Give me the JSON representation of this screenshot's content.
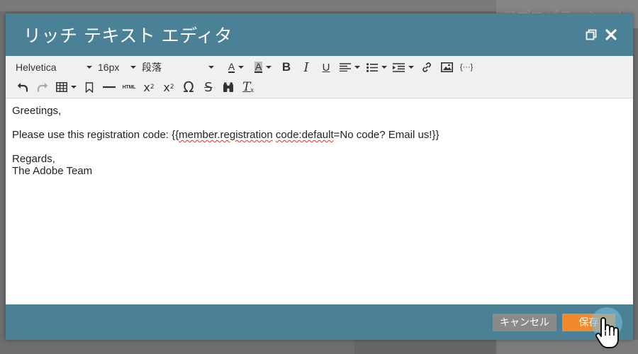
{
  "background": {
    "panel_title": "☐プロパティシート"
  },
  "dialog": {
    "title": "リッチ テキスト エディタ",
    "header_icons": [
      "restore-window-icon",
      "close-icon"
    ]
  },
  "toolbar": {
    "font_family": "Helvetica",
    "font_size": "16px",
    "block_format": "段落",
    "html_label": "HTML",
    "token_label": "{···}",
    "row1_icons": [
      "text-color-icon",
      "highlight-color-icon",
      "bold-icon",
      "italic-icon",
      "underline-icon",
      "align-icon",
      "bullet-list-icon",
      "indent-icon",
      "link-icon",
      "image-icon",
      "token-icon"
    ],
    "row2_icons": [
      "undo-icon",
      "redo-icon",
      "table-icon",
      "bookmark-icon",
      "horizontal-rule-icon",
      "html-icon",
      "subscript-icon",
      "superscript-icon",
      "special-char-icon",
      "strikethrough-icon",
      "find-icon",
      "clear-format-icon"
    ]
  },
  "editor": {
    "greeting": "Greetings,",
    "line_prefix": "Please use this registration code: {{",
    "token_word1": "member.registration",
    "token_space": " ",
    "token_word2": "code:default",
    "line_suffix": "=No code? Email us!}}",
    "closing": "Regards,",
    "signature": "The Adobe Team"
  },
  "footer": {
    "cancel_label": "キャンセル",
    "save_label": "保存"
  },
  "colors": {
    "header": "#4a8196",
    "toolbar": "#f0f0f0",
    "cancel": "#8a8a8a",
    "save": "#f08a2c"
  }
}
